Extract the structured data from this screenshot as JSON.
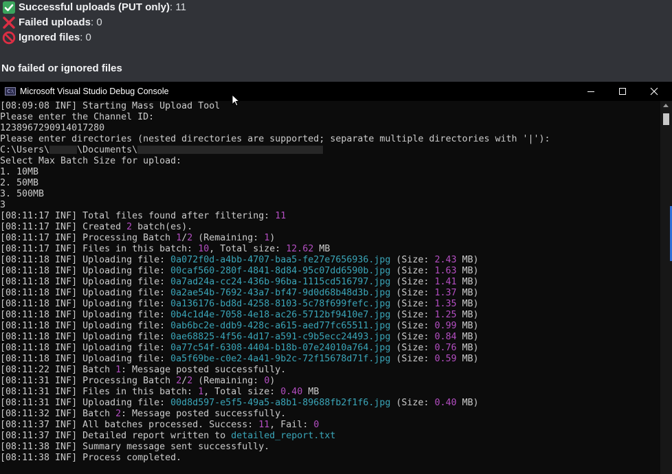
{
  "background_message": {
    "successful_label": "Successful uploads (PUT only)",
    "successful_value": ": 11",
    "failed_label": "Failed uploads",
    "failed_value": ": 0",
    "ignored_label": "Ignored files",
    "ignored_value": ": 0",
    "summary": "No failed or ignored files",
    "icons": [
      "check-mark-icon",
      "cross-mark-icon",
      "prohibited-icon"
    ],
    "colors": {
      "check": "#3ba55d",
      "cross": "#dd2e44",
      "prohibited": "#dd2e44"
    }
  },
  "window": {
    "title": "Microsoft Visual Studio Debug Console",
    "controls": [
      "minimize",
      "maximize",
      "close"
    ]
  },
  "console": {
    "intro_lines": [
      [
        {
          "t": "[08:09:08 INF] Starting Mass Upload Tool"
        }
      ],
      [
        {
          "t": "Please enter the Channel ID:"
        }
      ],
      [
        {
          "t": "1238967290914017280"
        }
      ],
      [
        {
          "t": "Please enter directories (nested directories are supported; separate multiple directories with '|'):"
        }
      ],
      [
        {
          "t": "C:\\Users\\"
        },
        {
          "t": "",
          "redacted": true,
          "w": 40
        },
        {
          "t": "\\Documents\\"
        },
        {
          "t": "",
          "redacted": true,
          "w": 270
        }
      ],
      [
        {
          "t": "Select Max Batch Size for upload:"
        }
      ],
      [
        {
          "t": "1. 10MB"
        }
      ],
      [
        {
          "t": "2. 50MB"
        }
      ],
      [
        {
          "t": "3. 500MB"
        }
      ],
      [
        {
          "t": "3"
        }
      ]
    ],
    "log_lines": [
      [
        {
          "t": "[08:11:17 INF] Total files found after filtering: "
        },
        {
          "t": "11",
          "c": "n"
        }
      ],
      [
        {
          "t": "[08:11:17 INF] Created "
        },
        {
          "t": "2",
          "c": "n"
        },
        {
          "t": " batch(es)."
        }
      ],
      [
        {
          "t": "[08:11:17 INF] Processing Batch "
        },
        {
          "t": "1",
          "c": "n"
        },
        {
          "t": "/"
        },
        {
          "t": "2",
          "c": "n"
        },
        {
          "t": " (Remaining: "
        },
        {
          "t": "1",
          "c": "n"
        },
        {
          "t": ")"
        }
      ],
      [
        {
          "t": "[08:11:17 INF] Files in this batch: "
        },
        {
          "t": "10",
          "c": "n"
        },
        {
          "t": ", Total size: "
        },
        {
          "t": "12.62",
          "c": "n"
        },
        {
          "t": " MB"
        }
      ],
      [
        {
          "t": "[08:11:18 INF] Uploading file: "
        },
        {
          "t": "0a072f0d-a4bb-4707-baa5-fe27e7656936.jpg",
          "c": "f"
        },
        {
          "t": " (Size: "
        },
        {
          "t": "2.43",
          "c": "n"
        },
        {
          "t": " MB)"
        }
      ],
      [
        {
          "t": "[08:11:18 INF] Uploading file: "
        },
        {
          "t": "00caf560-280f-4841-8d84-95c07dd6590b.jpg",
          "c": "f"
        },
        {
          "t": " (Size: "
        },
        {
          "t": "1.63",
          "c": "n"
        },
        {
          "t": " MB)"
        }
      ],
      [
        {
          "t": "[08:11:18 INF] Uploading file: "
        },
        {
          "t": "0a7ad24a-cc24-436b-96ba-1115cd516797.jpg",
          "c": "f"
        },
        {
          "t": " (Size: "
        },
        {
          "t": "1.41",
          "c": "n"
        },
        {
          "t": " MB)"
        }
      ],
      [
        {
          "t": "[08:11:18 INF] Uploading file: "
        },
        {
          "t": "0a2ae54b-7692-43a7-bf47-9d0d68b48d3b.jpg",
          "c": "f"
        },
        {
          "t": " (Size: "
        },
        {
          "t": "1.37",
          "c": "n"
        },
        {
          "t": " MB)"
        }
      ],
      [
        {
          "t": "[08:11:18 INF] Uploading file: "
        },
        {
          "t": "0a136176-bd8d-4258-8103-5c78f699fefc.jpg",
          "c": "f"
        },
        {
          "t": " (Size: "
        },
        {
          "t": "1.35",
          "c": "n"
        },
        {
          "t": " MB)"
        }
      ],
      [
        {
          "t": "[08:11:18 INF] Uploading file: "
        },
        {
          "t": "0b4c1d4e-7058-4e18-ac26-5712bf9410e7.jpg",
          "c": "f"
        },
        {
          "t": " (Size: "
        },
        {
          "t": "1.25",
          "c": "n"
        },
        {
          "t": " MB)"
        }
      ],
      [
        {
          "t": "[08:11:18 INF] Uploading file: "
        },
        {
          "t": "0ab6bc2e-ddb9-428c-a615-aed77fc65511.jpg",
          "c": "f"
        },
        {
          "t": " (Size: "
        },
        {
          "t": "0.99",
          "c": "n"
        },
        {
          "t": " MB)"
        }
      ],
      [
        {
          "t": "[08:11:18 INF] Uploading file: "
        },
        {
          "t": "0ae68825-4f56-4d17-a591-c9b5ecc24493.jpg",
          "c": "f"
        },
        {
          "t": " (Size: "
        },
        {
          "t": "0.84",
          "c": "n"
        },
        {
          "t": " MB)"
        }
      ],
      [
        {
          "t": "[08:11:18 INF] Uploading file: "
        },
        {
          "t": "0a77c54f-6308-4404-b18b-07e24010a764.jpg",
          "c": "f"
        },
        {
          "t": " (Size: "
        },
        {
          "t": "0.76",
          "c": "n"
        },
        {
          "t": " MB)"
        }
      ],
      [
        {
          "t": "[08:11:18 INF] Uploading file: "
        },
        {
          "t": "0a5f69be-c0e2-4a41-9b2c-72f15678d71f.jpg",
          "c": "f"
        },
        {
          "t": " (Size: "
        },
        {
          "t": "0.59",
          "c": "n"
        },
        {
          "t": " MB)"
        }
      ],
      [
        {
          "t": "[08:11:22 INF] Batch "
        },
        {
          "t": "1",
          "c": "n"
        },
        {
          "t": ": Message posted successfully."
        }
      ],
      [
        {
          "t": "[08:11:31 INF] Processing Batch "
        },
        {
          "t": "2",
          "c": "n"
        },
        {
          "t": "/"
        },
        {
          "t": "2",
          "c": "n"
        },
        {
          "t": " (Remaining: "
        },
        {
          "t": "0",
          "c": "n"
        },
        {
          "t": ")"
        }
      ],
      [
        {
          "t": "[08:11:31 INF] Files in this batch: "
        },
        {
          "t": "1",
          "c": "n"
        },
        {
          "t": ", Total size: "
        },
        {
          "t": "0.40",
          "c": "n"
        },
        {
          "t": " MB"
        }
      ],
      [
        {
          "t": "[08:11:31 INF] Uploading file: "
        },
        {
          "t": "00d8d597-e5f5-49a5-a8b1-89688fb2f1f6.jpg",
          "c": "f"
        },
        {
          "t": " (Size: "
        },
        {
          "t": "0.40",
          "c": "n"
        },
        {
          "t": " MB)"
        }
      ],
      [
        {
          "t": "[08:11:32 INF] Batch "
        },
        {
          "t": "2",
          "c": "n"
        },
        {
          "t": ": Message posted successfully."
        }
      ],
      [
        {
          "t": "[08:11:37 INF] All batches processed. Success: "
        },
        {
          "t": "11",
          "c": "n"
        },
        {
          "t": ", Fail: "
        },
        {
          "t": "0",
          "c": "n"
        }
      ],
      [
        {
          "t": "[08:11:37 INF] Detailed report written to "
        },
        {
          "t": "detailed_report.txt",
          "c": "f"
        }
      ],
      [
        {
          "t": "[08:11:38 INF] Summary message sent successfully."
        }
      ],
      [
        {
          "t": "[08:11:38 INF] Process completed."
        }
      ]
    ],
    "colors": {
      "text": "#cccccc",
      "number": "#b44ec2",
      "filename": "#3aa6b9",
      "background": "#0c0c0c"
    }
  }
}
